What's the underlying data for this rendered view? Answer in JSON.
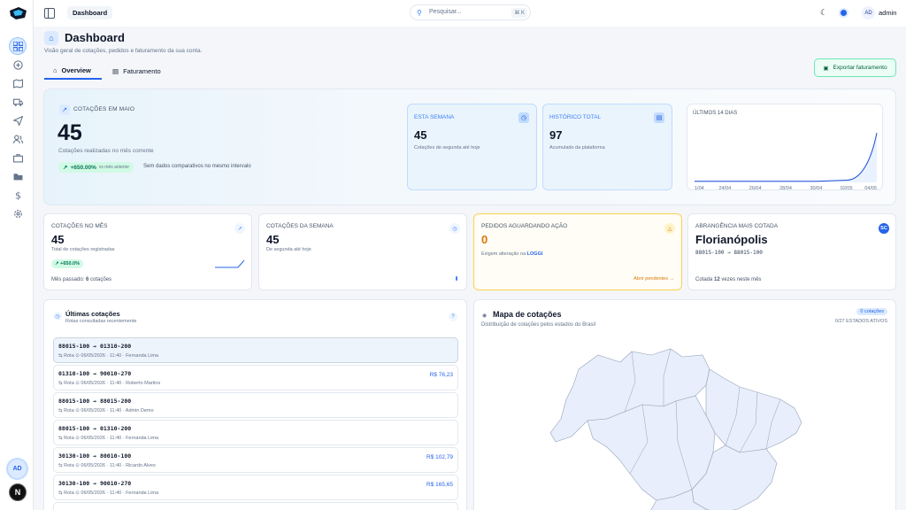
{
  "topbar": {
    "breadcrumb": "Dashboard",
    "search_placeholder": "Pesquisar...",
    "shortcut": "⌘ K",
    "user_initials": "AD",
    "user_name": "admin"
  },
  "sidebar": {
    "avatar_initials": "AD",
    "footer_badge": "N",
    "items": [
      "dashboard",
      "quotes",
      "map",
      "truck",
      "send",
      "users",
      "briefcase",
      "folder",
      "dollar",
      "settings"
    ]
  },
  "page": {
    "title": "Dashboard",
    "subtitle": "Visão geral de cotações, pedidos e faturamento da sua conta.",
    "tabs": [
      "Overview",
      "Faturamento"
    ],
    "export_label": "Exportar faturamento"
  },
  "hero": {
    "label": "COTAÇÕES EM MAIO",
    "value": "45",
    "description": "Cotações realizadas no mês corrente",
    "change": "+650.00%",
    "change_suffix": "vs mês anterior",
    "note": "Sem dados comparativos no mesmo intervalo",
    "week": {
      "label": "ESTA SEMANA",
      "value": "45",
      "description": "Cotações de segunda até hoje"
    },
    "total": {
      "label": "HISTÓRICO TOTAL",
      "value": "97",
      "description": "Acumulado da plataforma"
    },
    "spark_label": "ÚLTIMOS 14 DIAS",
    "spark_ticks": [
      "1/04",
      "24/04",
      "26/04",
      "28/04",
      "30/04",
      "02/05",
      "04/05"
    ]
  },
  "chart_data": {
    "type": "area",
    "title": "ÚLTIMOS 14 DIAS",
    "categories": [
      "1/04",
      "24/04",
      "26/04",
      "28/04",
      "30/04",
      "02/05",
      "04/05"
    ],
    "values": [
      1,
      1,
      1,
      1,
      1,
      2,
      45
    ],
    "grid": false
  },
  "cards": [
    {
      "label": "COTAÇÕES NO MÊS",
      "value": "45",
      "description": "Total de cotações registradas",
      "pill": "+650.0%",
      "foot_prefix": "Mês passado:",
      "foot_value": "6",
      "foot_suffix": "cotações"
    },
    {
      "label": "COTAÇÕES DA SEMANA",
      "value": "45",
      "description": "De segunda até hoje"
    },
    {
      "label": "PEDIDOS AGUARDANDO AÇÃO",
      "value": "0",
      "description_prefix": "Exigem alteração na",
      "description_link": "LOGGI",
      "corner": "Abrir pendentes"
    },
    {
      "label": "ABRANGÊNCIA MAIS COTADA",
      "value": "Florianópolis",
      "badge": "SC",
      "ceps": "88015-100 → 88015-100",
      "foot_prefix": "Cotada",
      "foot_value": "12",
      "foot_suffix": "vezes neste mês"
    }
  ],
  "quotes_panel": {
    "title": "Últimas cotações",
    "subtitle": "Rotas consultadas recentemente",
    "help": "?",
    "rows": [
      {
        "route": "88015-100 → 01310-200",
        "meta": "⇆ Rota  ⊙ 06/05/2026 · 11:40 · Fernanda Lima",
        "price": ""
      },
      {
        "route": "01310-100 → 90010-270",
        "meta": "⇆ Rota  ⊙ 06/05/2026 · 11:40 · Roberto Martins",
        "price": "R$ 76,23"
      },
      {
        "route": "88015-100 → 88015-200",
        "meta": "⇆ Rota  ⊙ 06/05/2026 · 11:40 · Admin Demo",
        "price": ""
      },
      {
        "route": "88015-100 → 01310-200",
        "meta": "⇆ Rota  ⊙ 06/05/2026 · 11:40 · Fernanda Lima",
        "price": ""
      },
      {
        "route": "30130-100 → 80010-100",
        "meta": "⇆ Rota  ⊙ 06/05/2026 · 11:40 · Ricardo Alves",
        "price": "R$ 102,79"
      },
      {
        "route": "30130-100 → 90010-270",
        "meta": "⇆ Rota  ⊙ 06/05/2026 · 11:40 · Fernanda Lima",
        "price": "R$ 165,65"
      }
    ]
  },
  "map_panel": {
    "title": "Mapa de cotações",
    "subtitle": "Distribuição de cotações pelos estados do Brasil",
    "badge": "0 cotações",
    "states_active": "0/27 ESTADOS ATIVOS"
  },
  "colors": {
    "accent": "#2563eb",
    "success": "#047857",
    "warning": "#d97706",
    "map_fill": "#e8eefb"
  }
}
